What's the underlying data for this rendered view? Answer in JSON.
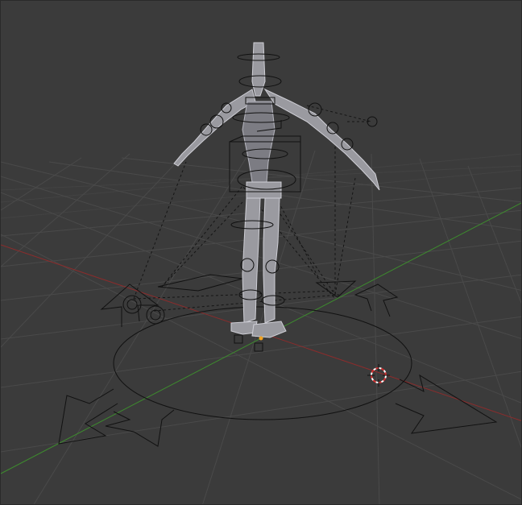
{
  "viewport": {
    "background": "#3b3b3b",
    "grid_color": "#4a4a4a",
    "x_axis_color": "#8b2c2c",
    "y_axis_color": "#3d8b2e"
  },
  "scene": {
    "object": "armature-with-character-mesh",
    "controls": [
      "root-arrow-control",
      "ik-pole-targets",
      "foot-controls"
    ],
    "cursor": "3d-cursor-icon",
    "origin_marker_color": "#f0a020"
  }
}
